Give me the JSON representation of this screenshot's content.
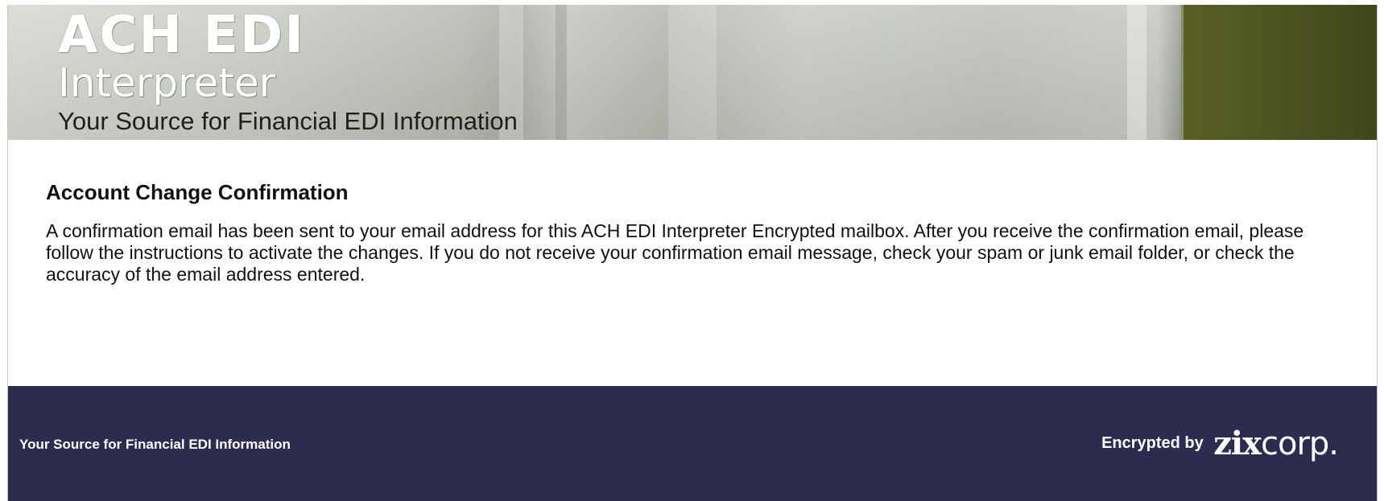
{
  "header": {
    "logo_line1": "ACH EDI",
    "logo_line2": "Interpreter",
    "tagline": "Your Source for Financial EDI Information"
  },
  "main": {
    "title": "Account Change Confirmation",
    "message": "A confirmation email has been sent to your email address for this ACH EDI Interpreter Encrypted mailbox. After you receive the confirmation email, please follow the instructions to activate the changes. If you do not receive your confirmation email message, check your spam or junk email folder, or check the accuracy of the email address entered."
  },
  "footer": {
    "tagline": "Your Source for Financial EDI Information",
    "encrypted_by": "Encrypted by",
    "brand_zix": "zix",
    "brand_corp": "corp."
  },
  "colors": {
    "footer_bg": "#2e2c4e",
    "banner_olive": "#4c5320",
    "text": "#111111"
  }
}
